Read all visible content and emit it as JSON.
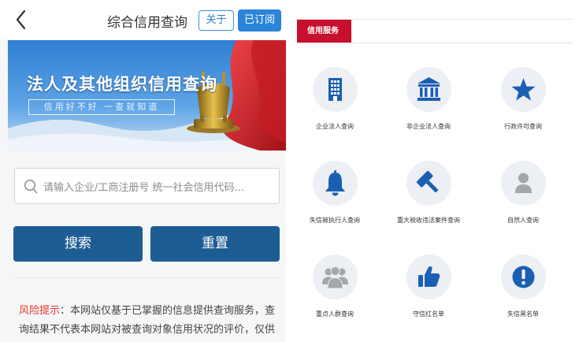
{
  "header": {
    "back_icon": "chevron-left-icon",
    "title": "综合信用查询",
    "about_label": "关于",
    "subscribed_label": "已订阅"
  },
  "banner": {
    "title": "法人及其他组织信用查询",
    "subtitle": "信用好不好 一查就知道"
  },
  "search": {
    "placeholder": "请输入企业/工商注册号 统一社会信用代码...",
    "search_label": "搜索",
    "reset_label": "重置"
  },
  "risk": {
    "label": "风险提示",
    "text": "：本网站仅基于已掌握的信息提供查询服务，查询结果不代表本网站对被查询对象信用状况的评价，仅供参考，请"
  },
  "services_tab": "信用服务",
  "services": [
    {
      "label": "企业法人查询",
      "icon": "building-icon"
    },
    {
      "label": "非企业法人查询",
      "icon": "institution-icon"
    },
    {
      "label": "行政许可查询",
      "icon": "star-icon"
    },
    {
      "label": "失信被执行人查询",
      "icon": "bell-icon"
    },
    {
      "label": "重大税收违法案件查询",
      "icon": "gavel-icon"
    },
    {
      "label": "自然人查询",
      "icon": "person-icon"
    },
    {
      "label": "重点人群查询",
      "icon": "group-icon"
    },
    {
      "label": "守信红名单",
      "icon": "thumbs-up-icon"
    },
    {
      "label": "失信黑名单",
      "icon": "exclamation-icon"
    }
  ],
  "colors": {
    "primary_button": "#1e5d94",
    "subscribe_button": "#2b84d8",
    "tab_red": "#c8102e",
    "icon_blue": "#1b5fb3",
    "icon_gray": "#a3a6ab",
    "risk_red": "#e5392b"
  }
}
